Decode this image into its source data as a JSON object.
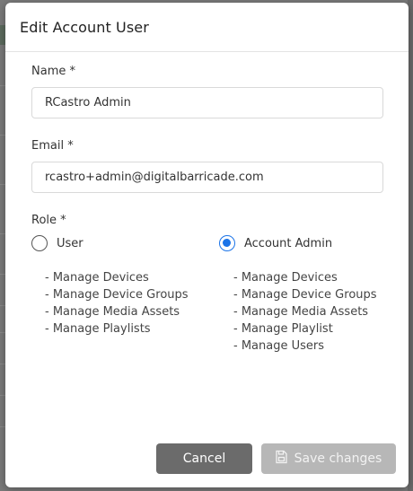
{
  "modal": {
    "title": "Edit Account User"
  },
  "form": {
    "name": {
      "label": "Name *",
      "value": "RCastro Admin"
    },
    "email": {
      "label": "Email *",
      "value": "rcastro+admin@digitalbarricade.com"
    },
    "role": {
      "label": "Role *",
      "options": [
        {
          "label": "User",
          "selected": false,
          "permissions": [
            "- Manage Devices",
            "- Manage Device Groups",
            "- Manage Media Assets",
            "- Manage Playlists"
          ]
        },
        {
          "label": "Account Admin",
          "selected": true,
          "permissions": [
            "- Manage Devices",
            "- Manage Device Groups",
            "- Manage Media Assets",
            "- Manage Playlist",
            "- Manage Users"
          ]
        }
      ]
    }
  },
  "footer": {
    "cancel_label": "Cancel",
    "save_label": "Save changes",
    "save_icon": "save-icon"
  },
  "colors": {
    "accent": "#1a73e8",
    "cancel_bg": "#6b6b6b",
    "save_bg_disabled": "#b7b7b7"
  }
}
